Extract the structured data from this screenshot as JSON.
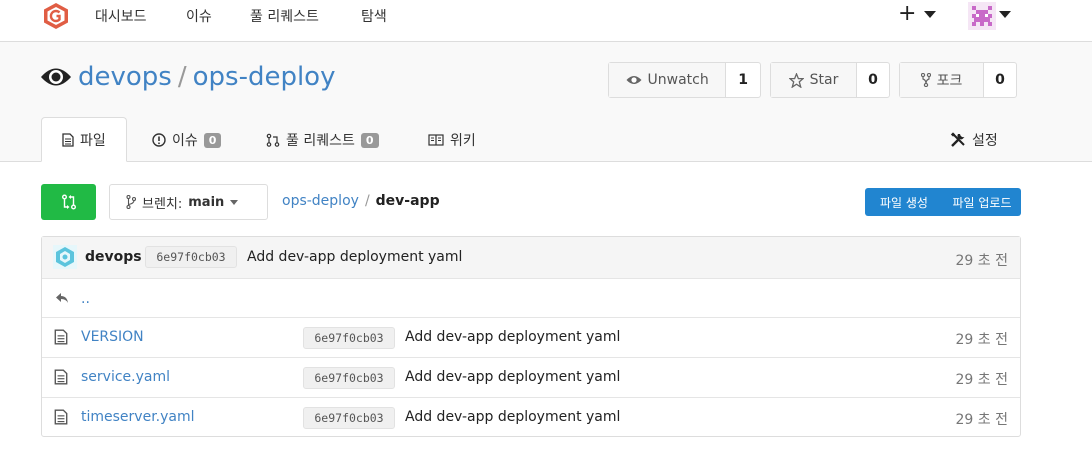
{
  "nav": {
    "items": [
      "대시보드",
      "이슈",
      "풀 리퀘스트",
      "탐색"
    ],
    "plus": "+"
  },
  "repo": {
    "owner": "devops",
    "separator": "/",
    "name": "ops-deploy"
  },
  "actions": {
    "watch": {
      "label": "Unwatch",
      "count": "1"
    },
    "star": {
      "label": "Star",
      "count": "0"
    },
    "fork": {
      "label": "포크",
      "count": "0"
    }
  },
  "tabs": {
    "files": {
      "label": "파일"
    },
    "issues": {
      "label": "이슈",
      "count": "0"
    },
    "pulls": {
      "label": "풀 리퀘스트",
      "count": "0"
    },
    "wiki": {
      "label": "위키"
    },
    "settings": {
      "label": "설정"
    }
  },
  "toolbar": {
    "branch_label": "브렌치:",
    "branch_value": "main",
    "breadcrumb_root": "ops-deploy",
    "breadcrumb_sep": "/",
    "breadcrumb_current": "dev-app",
    "new_file": "파일 생성",
    "upload_file": "파일 업로드"
  },
  "latest_commit": {
    "author": "devops",
    "sha": "6e97f0cb03",
    "message": "Add dev-app deployment yaml",
    "time": "29 초 전"
  },
  "parent_dir": "..",
  "files": [
    {
      "name": "VERSION",
      "sha": "6e97f0cb03",
      "message": "Add dev-app deployment yaml",
      "time": "29 초 전"
    },
    {
      "name": "service.yaml",
      "sha": "6e97f0cb03",
      "message": "Add dev-app deployment yaml",
      "time": "29 초 전"
    },
    {
      "name": "timeserver.yaml",
      "sha": "6e97f0cb03",
      "message": "Add dev-app deployment yaml",
      "time": "29 초 전"
    }
  ],
  "colors": {
    "accent": "#4183c4",
    "green": "#21ba45",
    "blue": "#2185d0",
    "logo": "#e05d44"
  }
}
